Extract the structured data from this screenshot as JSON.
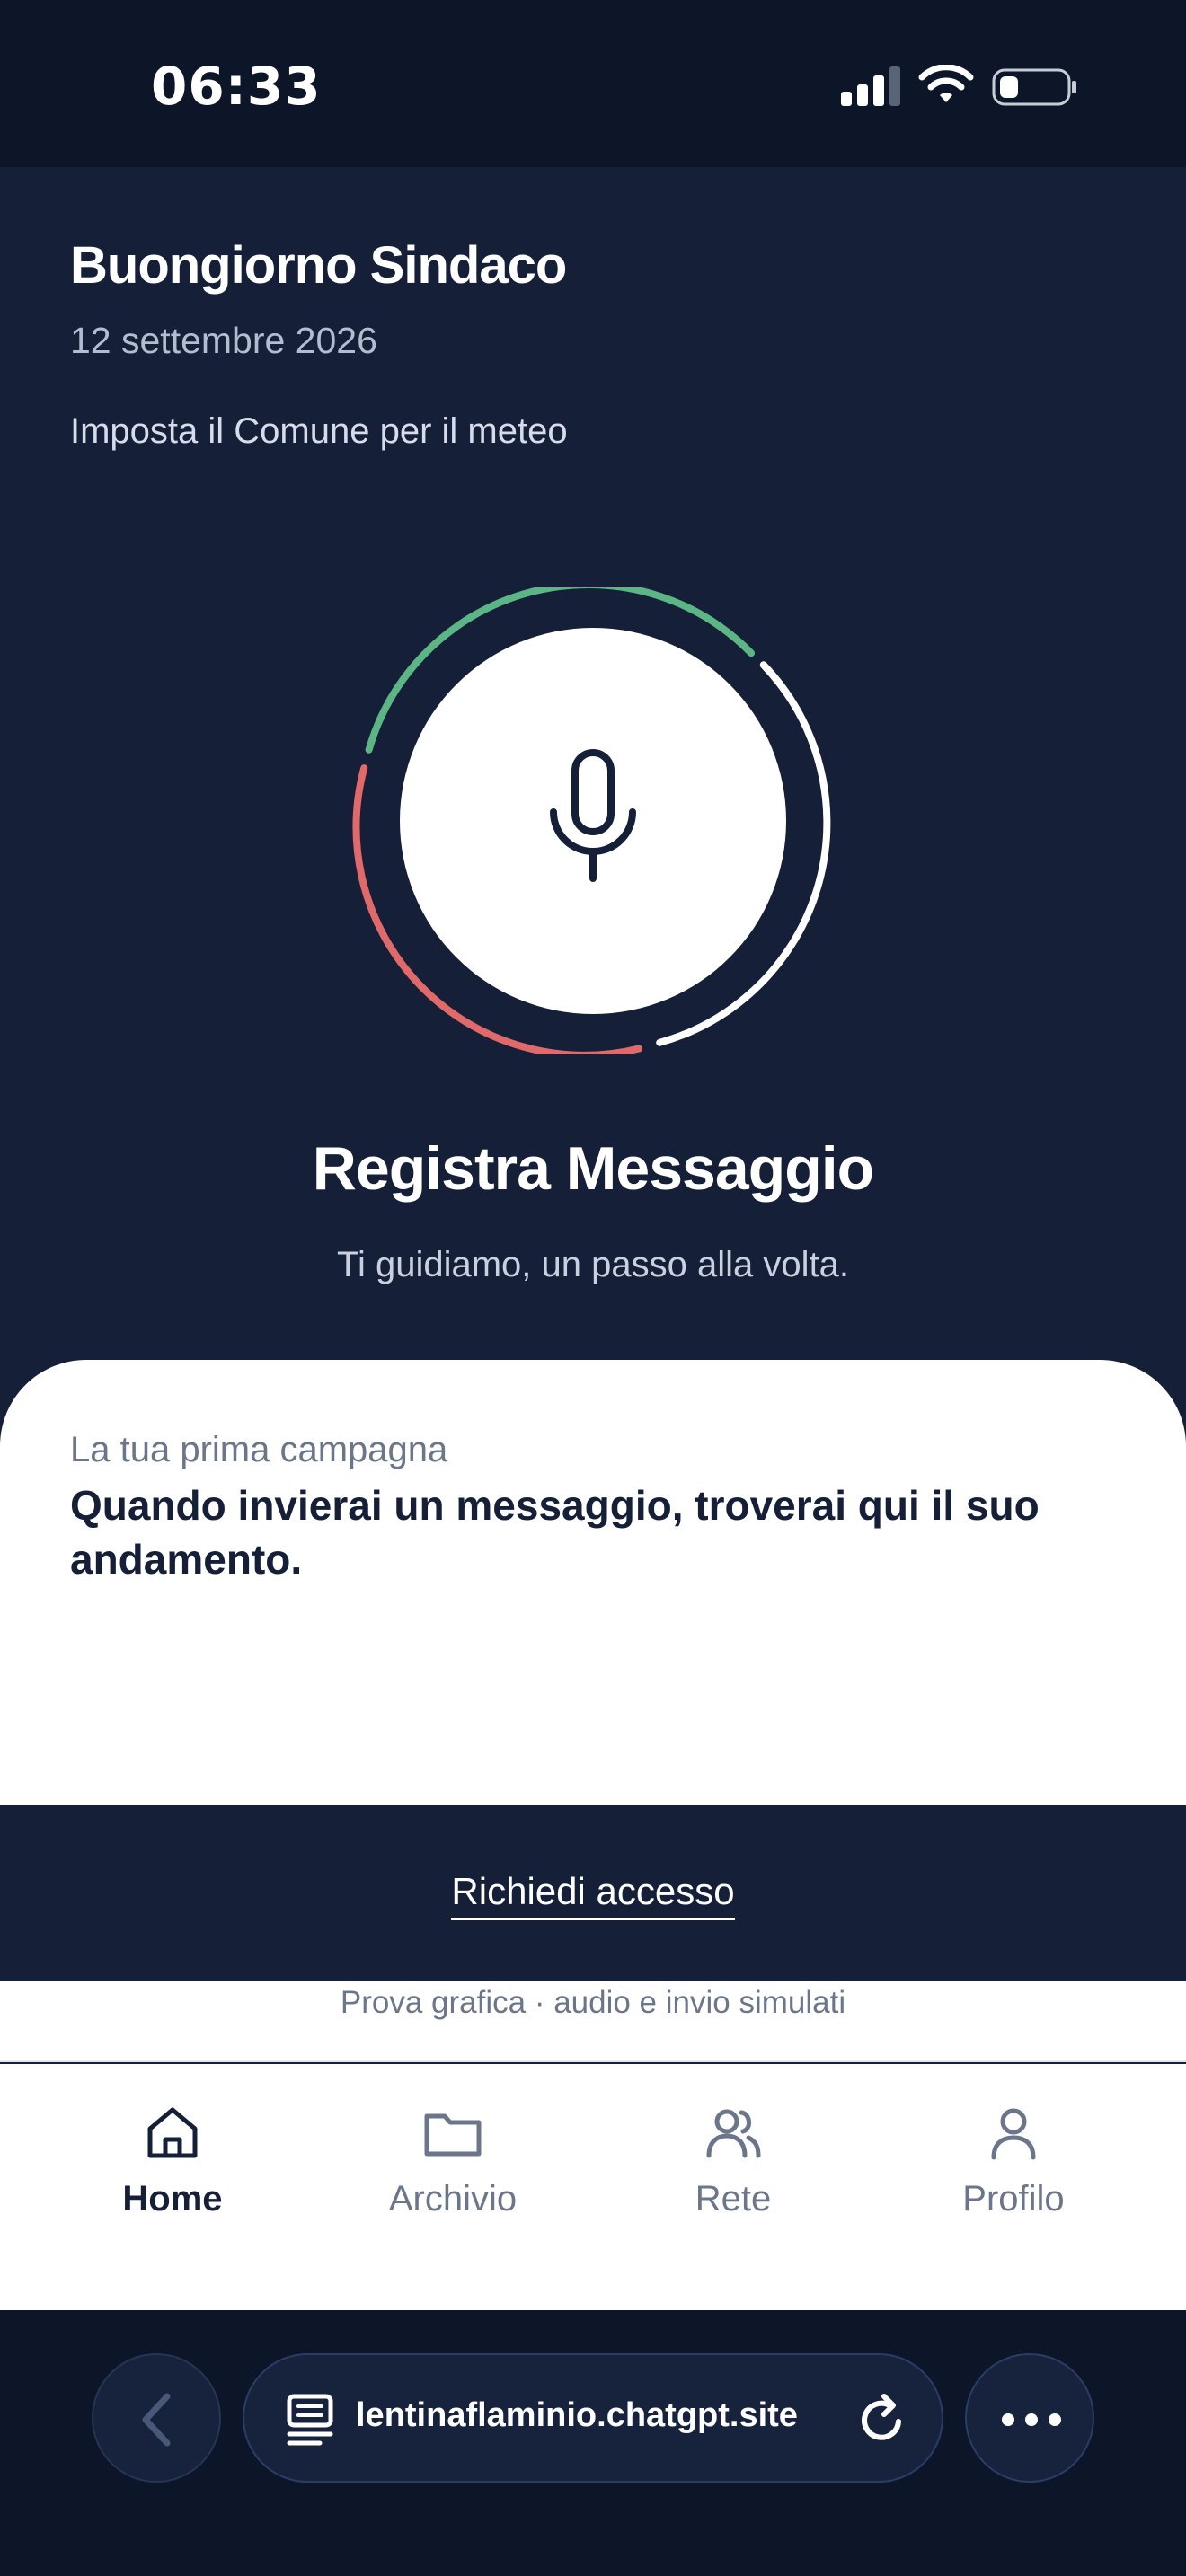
{
  "status_bar": {
    "time": "06:33"
  },
  "header": {
    "greeting": "Buongiorno Sindaco",
    "date": "12 settembre 2026",
    "weather_link": "Imposta il Comune per il meteo"
  },
  "recorder": {
    "title": "Registra Messaggio",
    "subtitle": "Ti guidiamo, un passo alla volta.",
    "ring_colors": [
      "#5bb585",
      "#ffffff",
      "#e06a6a"
    ]
  },
  "campaign_card": {
    "label": "La tua prima campagna",
    "text": "Quando invierai un messaggio, troverai qui il suo andamento."
  },
  "access": {
    "link_label": "Richiedi accesso"
  },
  "demo_note": "Prova grafica · audio e invio simulati",
  "tabs": [
    {
      "label": "Home",
      "icon": "home-icon",
      "active": true
    },
    {
      "label": "Archivio",
      "icon": "folder-icon",
      "active": false
    },
    {
      "label": "Rete",
      "icon": "people-icon",
      "active": false
    },
    {
      "label": "Profilo",
      "icon": "user-icon",
      "active": false
    }
  ],
  "browser": {
    "url": "lentinaflaminio.chatgpt.site"
  },
  "colors": {
    "background": "#151f38",
    "status_bar": "#0c1628",
    "card": "#ffffff",
    "text_dark": "#152038",
    "text_muted": "#6b768a"
  }
}
